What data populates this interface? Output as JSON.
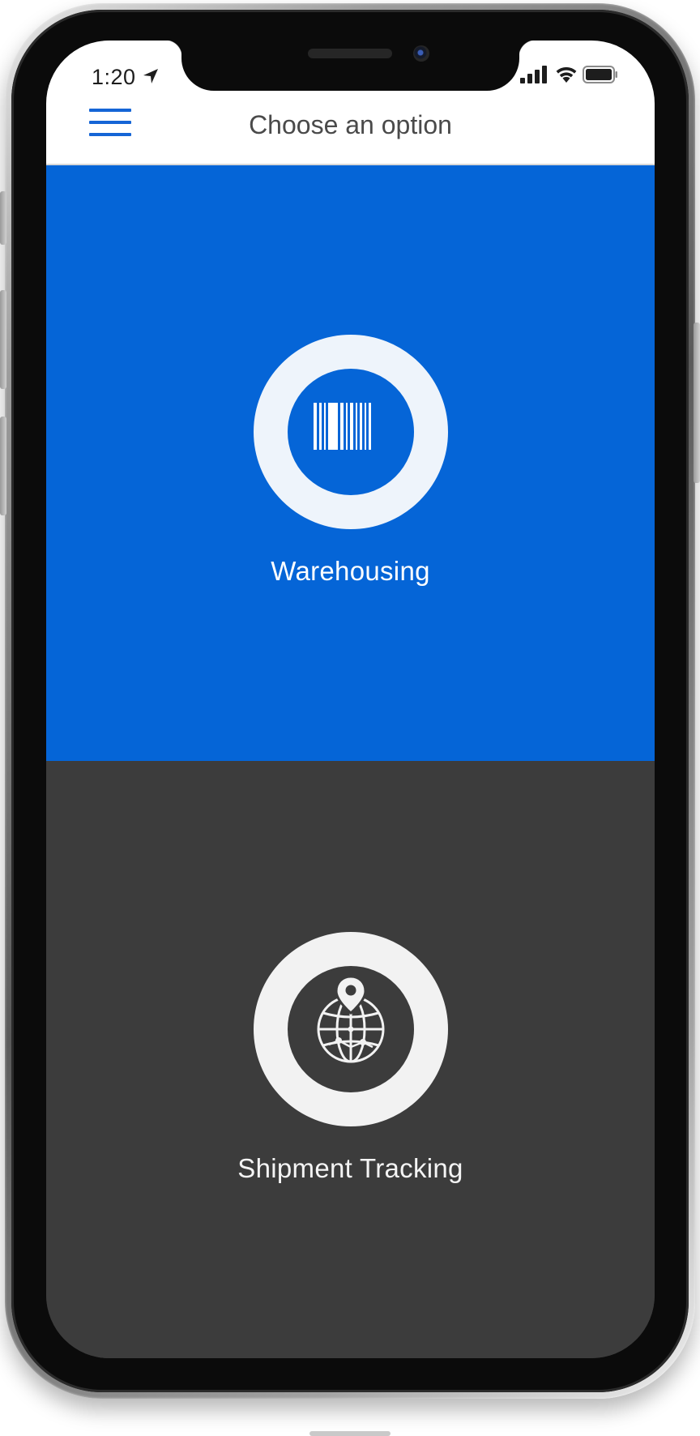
{
  "status_bar": {
    "time": "1:20",
    "icons": [
      "location-arrow-icon",
      "cellular-signal-icon",
      "wifi-icon",
      "battery-icon"
    ]
  },
  "header": {
    "menu_icon": "hamburger-menu-icon",
    "title": "Choose an option"
  },
  "options": [
    {
      "label": "Warehousing",
      "icon": "barcode-icon",
      "background": "#0565d7"
    },
    {
      "label": "Shipment Tracking",
      "icon": "globe-location-icon",
      "background": "#3c3c3c"
    }
  ],
  "colors": {
    "accent": "#1565d6",
    "warehouse_blue": "#0565d7",
    "dark_panel": "#3c3c3c",
    "header_bg": "#ffffff"
  }
}
